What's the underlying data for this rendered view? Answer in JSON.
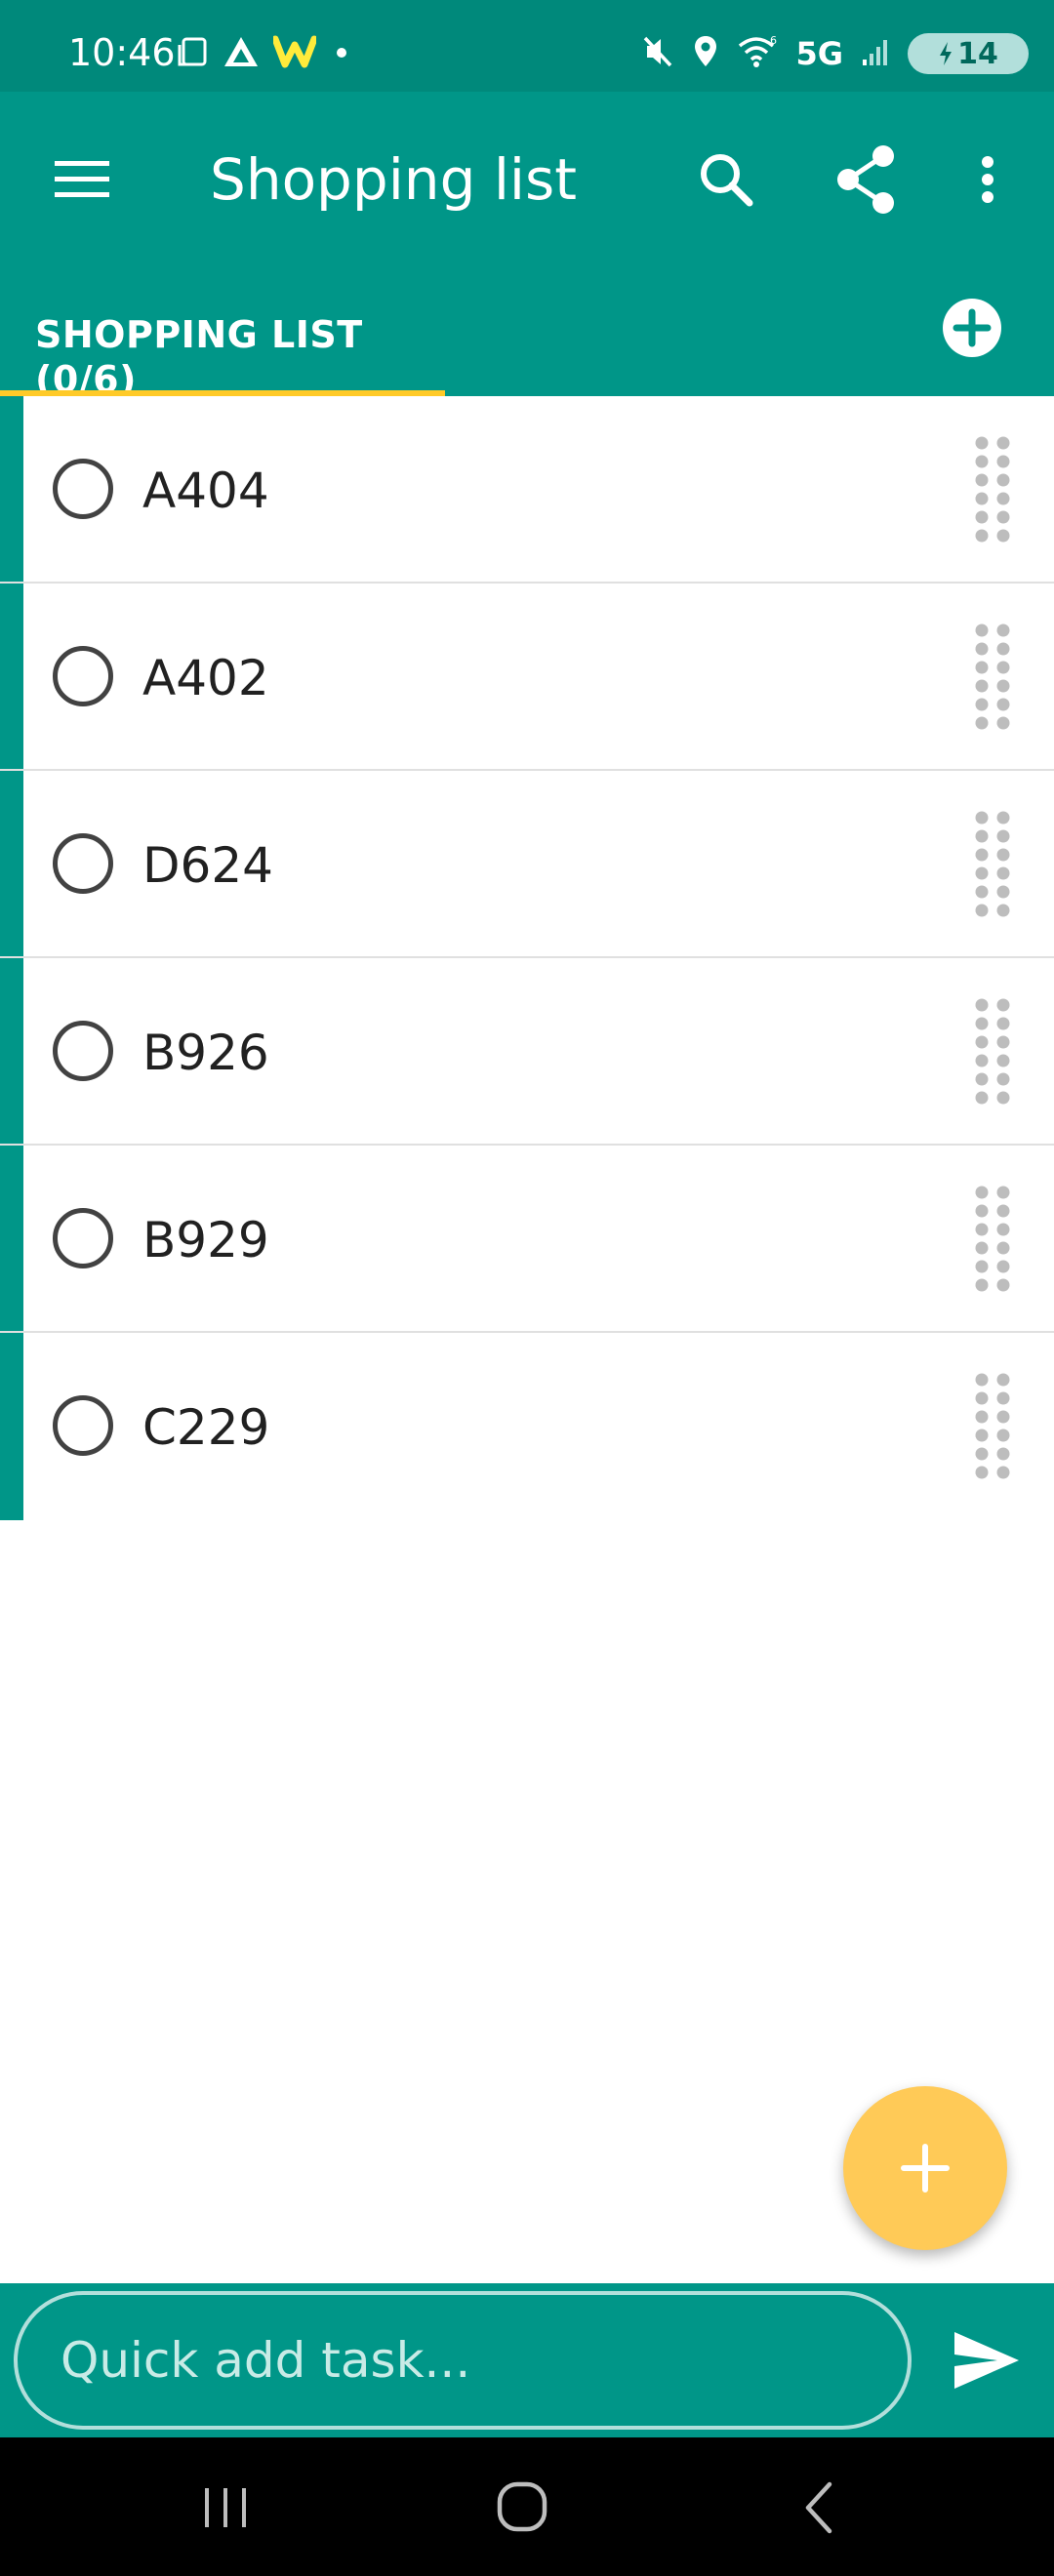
{
  "status_bar": {
    "time": "10:46",
    "network": "5G",
    "battery": "14",
    "left_icons": [
      "screen-icon",
      "app-triangle-icon",
      "w-logo-icon",
      "dot-icon"
    ],
    "right_icons": [
      "mute-icon",
      "location-icon",
      "wifi-icon",
      "signal-icon",
      "battery-icon"
    ]
  },
  "app_bar": {
    "title": "Shopping list",
    "icons": [
      "menu-icon",
      "search-icon",
      "share-icon",
      "more-vert-icon"
    ]
  },
  "tab": {
    "label": "SHOPPING LIST (0/6)",
    "add_icon": "add-circle-icon"
  },
  "items": [
    {
      "label": "A404",
      "checked": false
    },
    {
      "label": "A402",
      "checked": false
    },
    {
      "label": "D624",
      "checked": false
    },
    {
      "label": "B926",
      "checked": false
    },
    {
      "label": "B929",
      "checked": false
    },
    {
      "label": "C229",
      "checked": false
    }
  ],
  "quick_add": {
    "placeholder": "Quick add task...",
    "value": ""
  },
  "nav_bar": {
    "icons": [
      "recent-apps-icon",
      "home-icon",
      "back-icon"
    ]
  },
  "colors": {
    "primary": "#009688",
    "status_bar": "#00897b",
    "accent": "#ffca28",
    "fab": "#ffca57"
  }
}
